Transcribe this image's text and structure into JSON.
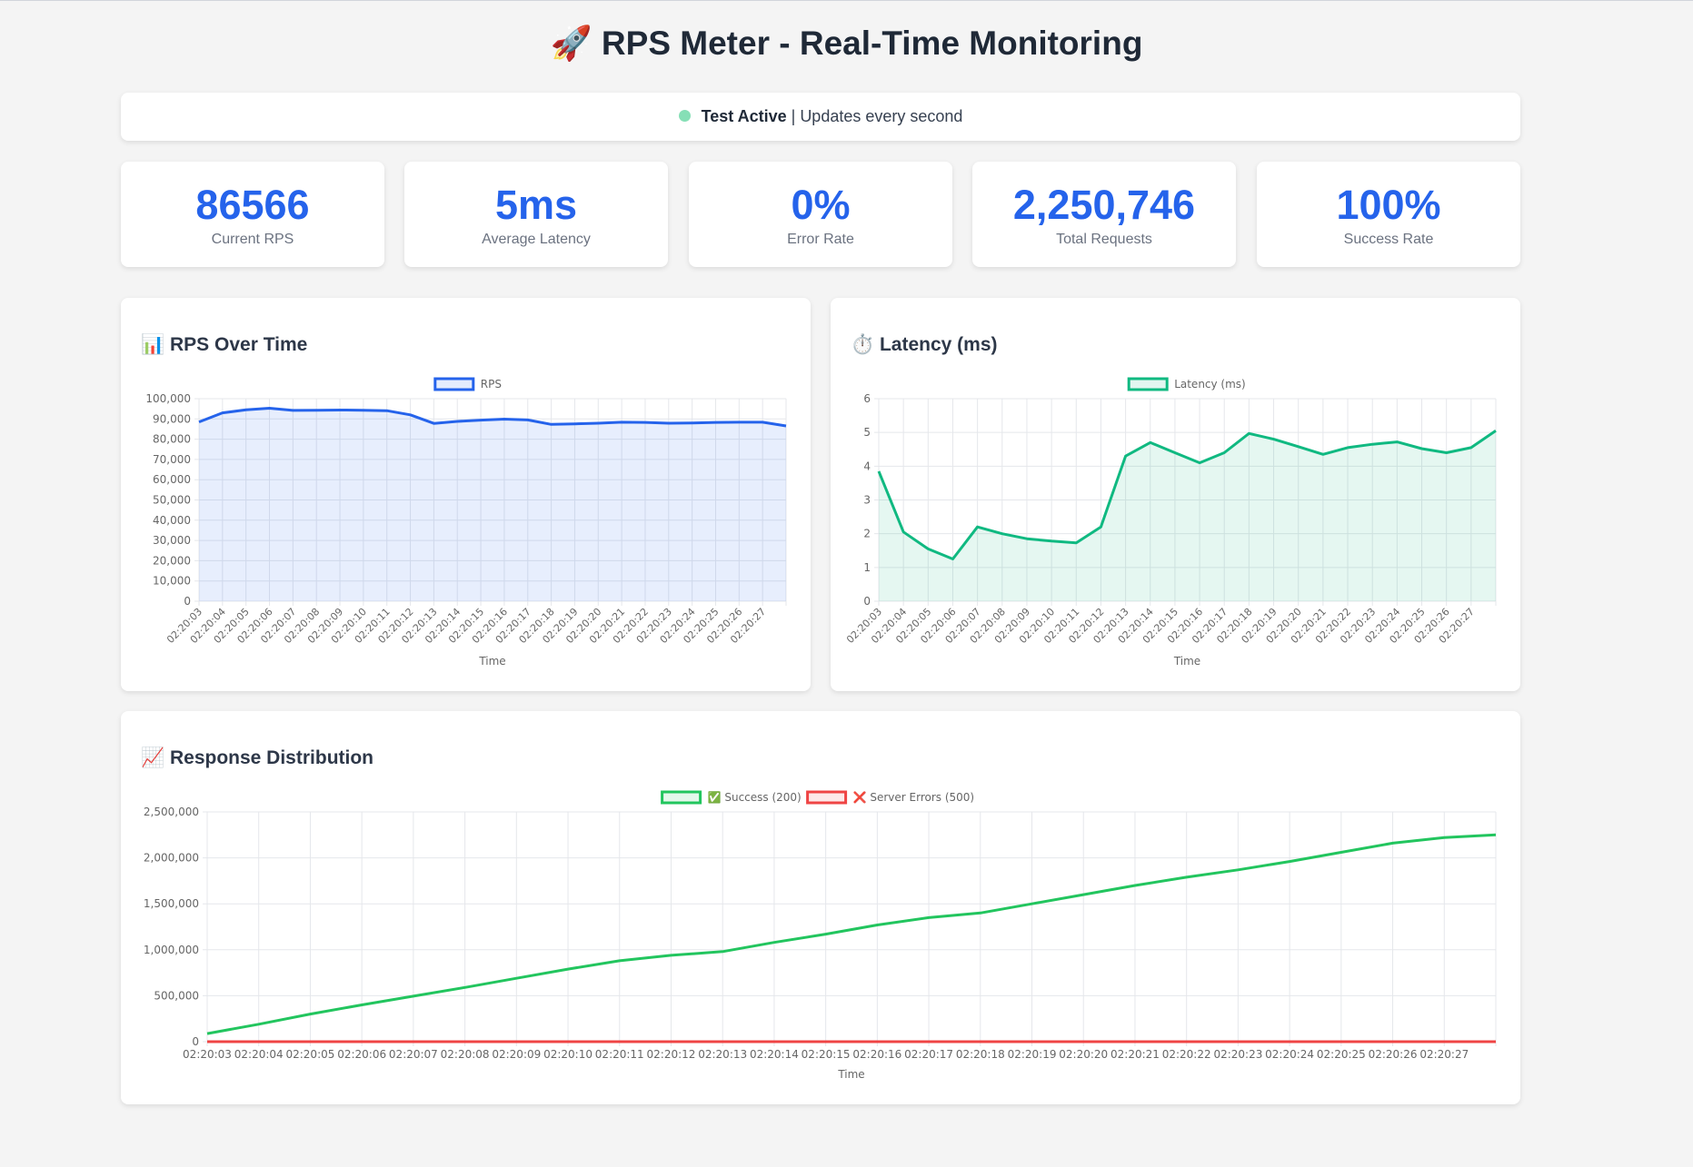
{
  "title": "🚀 RPS Meter - Real-Time Monitoring",
  "status": {
    "state": "Test Active",
    "separator": " | ",
    "detail": "Updates every second"
  },
  "colors": {
    "accent": "#2563eb",
    "success": "#22c55e",
    "error": "#ef4444",
    "latency": "#10b981",
    "status_dot": "#86dfb6"
  },
  "stats": [
    {
      "value": "86566",
      "label": "Current RPS"
    },
    {
      "value": "5ms",
      "label": "Average Latency"
    },
    {
      "value": "0%",
      "label": "Error Rate"
    },
    {
      "value": "2,250,746",
      "label": "Total Requests"
    },
    {
      "value": "100%",
      "label": "Success Rate"
    }
  ],
  "charts": {
    "rps": {
      "title": "📊 RPS Over Time"
    },
    "latency": {
      "title": "⏱️ Latency (ms)"
    },
    "distribution": {
      "title": "📈 Response Distribution"
    }
  },
  "chart_data": [
    {
      "type": "area",
      "xlabel": "Time",
      "ylim": [
        0,
        100000
      ],
      "yticks": [
        "0",
        "10,000",
        "20,000",
        "30,000",
        "40,000",
        "50,000",
        "60,000",
        "70,000",
        "80,000",
        "90,000",
        "100,000"
      ],
      "categories": [
        "02:20:03",
        "02:20:04",
        "02:20:05",
        "02:20:06",
        "02:20:07",
        "02:20:08",
        "02:20:09",
        "02:20:10",
        "02:20:11",
        "02:20:12",
        "02:20:13",
        "02:20:14",
        "02:20:15",
        "02:20:16",
        "02:20:17",
        "02:20:18",
        "02:20:19",
        "02:20:20",
        "02:20:21",
        "02:20:22",
        "02:20:23",
        "02:20:24",
        "02:20:25",
        "02:20:26",
        "02:20:27"
      ],
      "series": [
        {
          "name": "RPS",
          "color": "#2563eb",
          "values": [
            88500,
            93000,
            94500,
            95300,
            94200,
            94300,
            94400,
            94300,
            94100,
            92000,
            87800,
            88800,
            89400,
            89900,
            89500,
            87300,
            87600,
            87900,
            88400,
            88300,
            87900,
            88000,
            88300,
            88400,
            88400,
            86566
          ]
        }
      ],
      "grid": true,
      "legend": "top"
    },
    {
      "type": "area",
      "xlabel": "Time",
      "ylim": [
        0,
        6
      ],
      "yticks": [
        "0",
        "1",
        "2",
        "3",
        "4",
        "5",
        "6"
      ],
      "categories": [
        "02:20:03",
        "02:20:04",
        "02:20:05",
        "02:20:06",
        "02:20:07",
        "02:20:08",
        "02:20:09",
        "02:20:10",
        "02:20:11",
        "02:20:12",
        "02:20:13",
        "02:20:14",
        "02:20:15",
        "02:20:16",
        "02:20:17",
        "02:20:18",
        "02:20:19",
        "02:20:20",
        "02:20:21",
        "02:20:22",
        "02:20:23",
        "02:20:24",
        "02:20:25",
        "02:20:26",
        "02:20:27"
      ],
      "series": [
        {
          "name": "Latency (ms)",
          "color": "#10b981",
          "values": [
            3.85,
            2.05,
            1.55,
            1.25,
            2.2,
            2.0,
            1.85,
            1.78,
            1.73,
            2.2,
            4.3,
            4.7,
            4.4,
            4.1,
            4.4,
            4.97,
            4.8,
            4.58,
            4.35,
            4.55,
            4.65,
            4.72,
            4.52,
            4.4,
            4.55,
            5.05
          ]
        }
      ],
      "grid": true,
      "legend": "top"
    },
    {
      "type": "line",
      "xlabel": "Time",
      "ylim": [
        0,
        2500000
      ],
      "yticks": [
        "0",
        "500,000",
        "1,000,000",
        "1,500,000",
        "2,000,000",
        "2,500,000"
      ],
      "categories": [
        "02:20:03",
        "02:20:04",
        "02:20:05",
        "02:20:06",
        "02:20:07",
        "02:20:08",
        "02:20:09",
        "02:20:10",
        "02:20:11",
        "02:20:12",
        "02:20:13",
        "02:20:14",
        "02:20:15",
        "02:20:16",
        "02:20:17",
        "02:20:18",
        "02:20:19",
        "02:20:20",
        "02:20:21",
        "02:20:22",
        "02:20:23",
        "02:20:24",
        "02:20:25",
        "02:20:26",
        "02:20:27"
      ],
      "series": [
        {
          "name": "✅ Success (200)",
          "color": "#22c55e",
          "values": [
            88000,
            190000,
            300000,
            400000,
            495000,
            590000,
            690000,
            790000,
            880000,
            940000,
            980000,
            1080000,
            1170000,
            1270000,
            1350000,
            1400000,
            1500000,
            1600000,
            1700000,
            1790000,
            1870000,
            1960000,
            2060000,
            2160000,
            2220000,
            2250746
          ]
        },
        {
          "name": "❌ Server Errors (500)",
          "color": "#ef4444",
          "values": [
            0,
            0,
            0,
            0,
            0,
            0,
            0,
            0,
            0,
            0,
            0,
            0,
            0,
            0,
            0,
            0,
            0,
            0,
            0,
            0,
            0,
            0,
            0,
            0,
            0,
            0
          ]
        }
      ],
      "grid": true,
      "legend": "top"
    }
  ]
}
